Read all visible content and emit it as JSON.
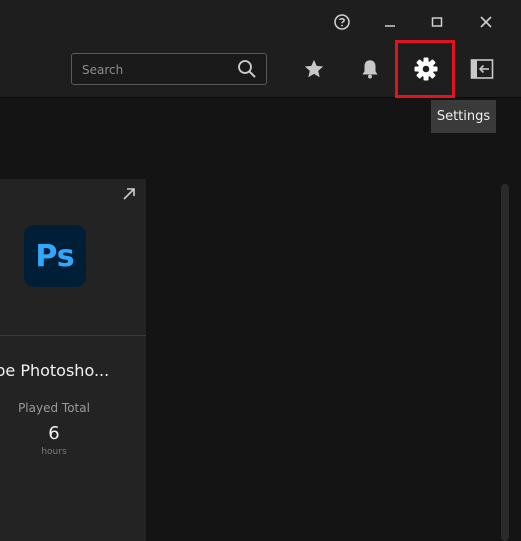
{
  "window_controls": {
    "help_icon": "help-circle-icon",
    "minimize_icon": "minimize-icon",
    "maximize_icon": "maximize-icon",
    "close_icon": "close-icon"
  },
  "toolbar": {
    "search": {
      "placeholder": "Search",
      "value": ""
    },
    "favorites_icon": "star-icon",
    "notifications_icon": "bell-icon",
    "settings_icon": "gear-icon",
    "sidebar_icon": "panel-collapse-icon"
  },
  "tooltip": {
    "text": "Settings"
  },
  "app_card": {
    "icon_text": "Ps",
    "name": "lobe Photosho...",
    "stat_label": "Played Total",
    "stat_value": "6",
    "stat_unit": "hours"
  },
  "colors": {
    "background": "#141414",
    "toolbar": "#1e1e1e",
    "card": "#232323",
    "highlight": "#e0141e",
    "ps_blue": "#31a8ff",
    "ps_bg": "#001e36"
  }
}
